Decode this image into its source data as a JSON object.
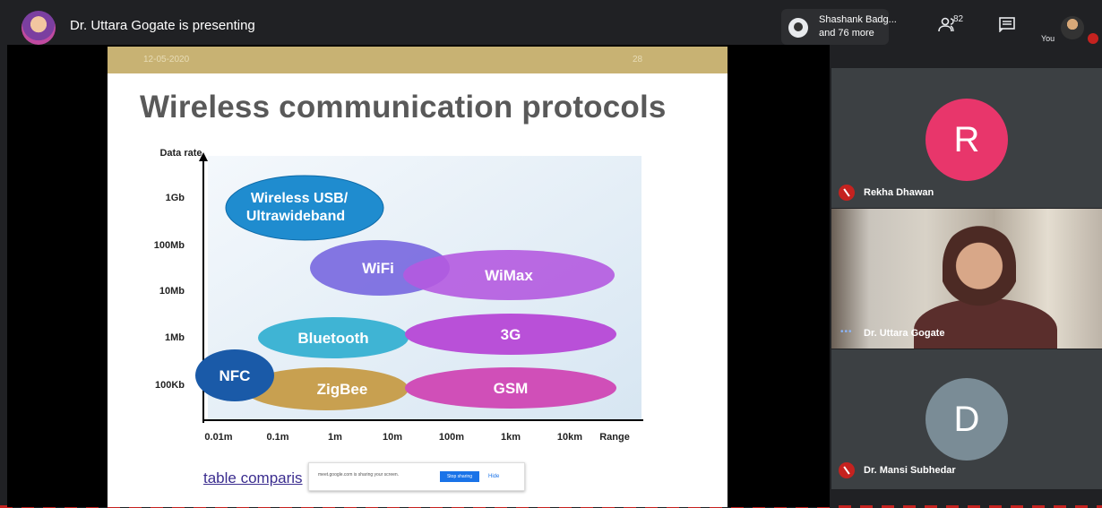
{
  "meeting": {
    "presenting_text": "Dr. Uttara Gogate is presenting",
    "participants_chip": {
      "line1": "Shashank Badg...",
      "line2": "and 76 more"
    },
    "people_count": "82",
    "you_label": "You"
  },
  "slide": {
    "date": "12-05-2020",
    "number": "28",
    "title": "Wireless communication protocols",
    "link_text": "table comparis",
    "diagram": {
      "y_axis_label": "Data rate",
      "y_ticks": [
        "1Gb",
        "100Mb",
        "10Mb",
        "1Mb",
        "100Kb"
      ],
      "x_ticks": [
        "0.01m",
        "0.1m",
        "1m",
        "10m",
        "100m",
        "1km",
        "10km"
      ],
      "x_axis_label": "Range",
      "bubbles": [
        {
          "label": "Wireless USB/ Ultrawideband",
          "color": "#1f8ccf"
        },
        {
          "label": "WiFi",
          "color": "#7a6ae0"
        },
        {
          "label": "WiMax",
          "color": "#b45ae0"
        },
        {
          "label": "Bluetooth",
          "color": "#3fb4d4"
        },
        {
          "label": "3G",
          "color": "#b950d8"
        },
        {
          "label": "NFC",
          "color": "#1a5aa8"
        },
        {
          "label": "ZigBee",
          "color": "#c8a050"
        },
        {
          "label": "GSM",
          "color": "#d04fb8"
        }
      ]
    }
  },
  "share_bar": {
    "text": "meet.google.com is sharing your screen.",
    "stop_label": "Stop sharing",
    "hide_label": "Hide"
  },
  "participants": [
    {
      "name": "Rekha Dhawan",
      "initial": "R",
      "color": "#e8366b",
      "muted": true
    },
    {
      "name": "Dr. Uttara Gogate",
      "speaking": true
    },
    {
      "name": "Dr. Mansi Subhedar",
      "initial": "D",
      "color": "#7a8c96",
      "muted": true
    }
  ],
  "colors": {
    "background": "#202124",
    "tile": "#3c4043",
    "slide_band": "#c8b273",
    "alert_red": "#c5221f"
  }
}
